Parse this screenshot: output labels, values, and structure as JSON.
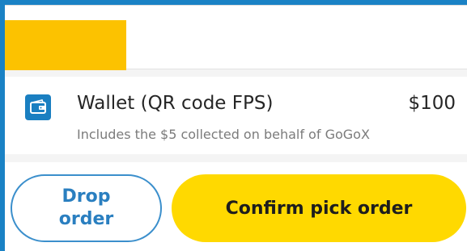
{
  "payment": {
    "method_label": "Wallet (QR code FPS)",
    "amount": "$100",
    "note": "Includes the $5 collected on behalf of GoGoX",
    "icon": "wallet-icon"
  },
  "actions": {
    "drop_label": "Drop order",
    "confirm_label": "Confirm pick order"
  },
  "colors": {
    "accent": "#fcc200",
    "confirm_bg": "#ffd900",
    "brand_blue": "#1a7fc1"
  }
}
